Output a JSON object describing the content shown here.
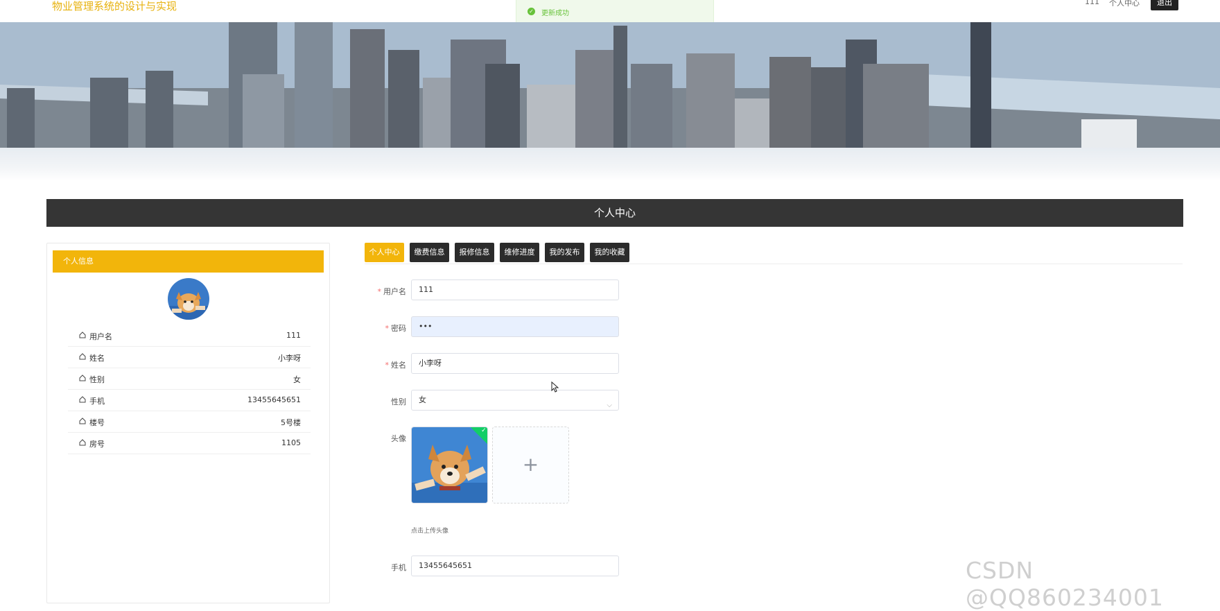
{
  "header": {
    "site_title": "物业管理系统的设计与实现",
    "username": "111",
    "personal_center": "个人中心",
    "logout": "退出"
  },
  "toast": {
    "message": "更新成功"
  },
  "section_title": "个人中心",
  "profile_card": {
    "title": "个人信息",
    "rows": [
      {
        "label": "用户名",
        "value": "111"
      },
      {
        "label": "姓名",
        "value": "小李呀"
      },
      {
        "label": "性别",
        "value": "女"
      },
      {
        "label": "手机",
        "value": "13455645651"
      },
      {
        "label": "楼号",
        "value": "5号楼"
      },
      {
        "label": "房号",
        "value": "1105"
      }
    ]
  },
  "tabs": [
    {
      "label": "个人中心",
      "active": true
    },
    {
      "label": "缴费信息",
      "active": false
    },
    {
      "label": "报修信息",
      "active": false
    },
    {
      "label": "维修进度",
      "active": false
    },
    {
      "label": "我的发布",
      "active": false
    },
    {
      "label": "我的收藏",
      "active": false
    }
  ],
  "form": {
    "username_label": "用户名",
    "username_value": "111",
    "password_label": "密码",
    "password_value": "•••",
    "name_label": "姓名",
    "name_value": "小李呀",
    "gender_label": "性别",
    "gender_value": "女",
    "avatar_label": "头像",
    "avatar_tip": "点击上传头像",
    "phone_label": "手机",
    "phone_value": "13455645651"
  },
  "colors": {
    "accent": "#f2b50b",
    "dark": "#2b2b2b",
    "success": "#67c23a"
  },
  "watermark": "CSDN @QQ860234001"
}
